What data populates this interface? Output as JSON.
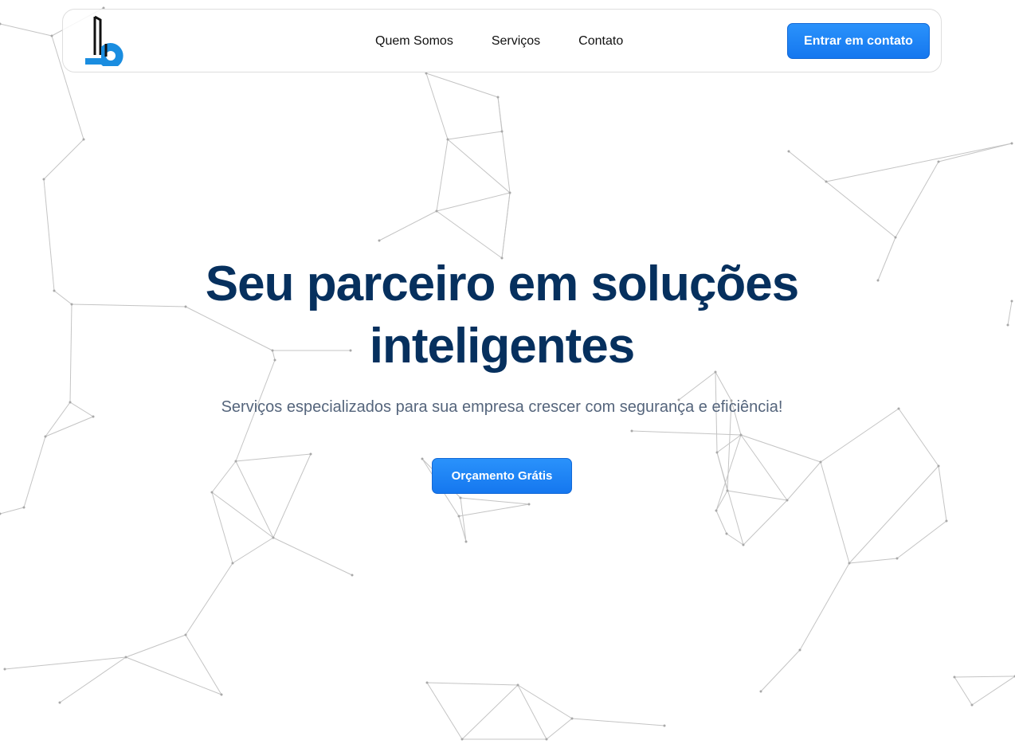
{
  "header": {
    "logo_icon": "brand-logo-icon",
    "nav": [
      {
        "label": "Quem Somos"
      },
      {
        "label": "Serviços"
      },
      {
        "label": "Contato"
      }
    ],
    "cta_label": "Entrar em contato"
  },
  "hero": {
    "title": "Seu parceiro em soluções inteligentes",
    "subtitle": "Serviços especializados para sua empresa crescer com segurança e eficiência!",
    "button_label": "Orçamento Grátis"
  },
  "colors": {
    "primary": "#1a80f5",
    "title": "#06305e",
    "subtitle": "#55657c",
    "background": "#ffffff"
  },
  "background": {
    "pattern": "network-nodes"
  }
}
